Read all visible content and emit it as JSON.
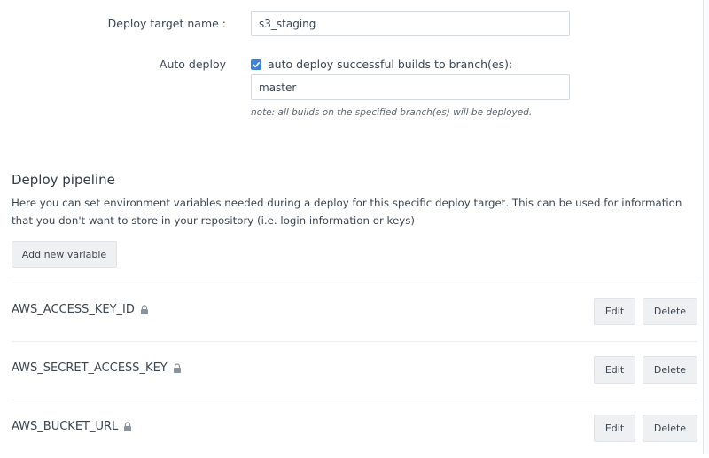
{
  "form": {
    "target_name_label": "Deploy target name :",
    "target_name_value": "s3_staging",
    "auto_deploy_label": "Auto deploy",
    "auto_deploy_checked": true,
    "auto_deploy_checkbox_label": "auto deploy successful builds to branch(es):",
    "branch_value": "master",
    "note": "note: all builds on the specified branch(es) will be deployed."
  },
  "pipeline": {
    "title": "Deploy pipeline",
    "description": "Here you can set environment variables needed during a deploy for this specific deploy target. This can be used for information that you don't want to store in your repository (i.e. login information or keys)",
    "add_button": "Add new variable",
    "edit_label": "Edit",
    "delete_label": "Delete",
    "variables": [
      {
        "name": "AWS_ACCESS_KEY_ID",
        "icon": "lock-icon"
      },
      {
        "name": "AWS_SECRET_ACCESS_KEY",
        "icon": "lock-icon"
      },
      {
        "name": "AWS_BUCKET_URL",
        "icon": "lock-icon"
      }
    ]
  },
  "colors": {
    "checkbox": "#3b82d6",
    "button_bg": "#eef0f2",
    "text": "#3b4651"
  }
}
